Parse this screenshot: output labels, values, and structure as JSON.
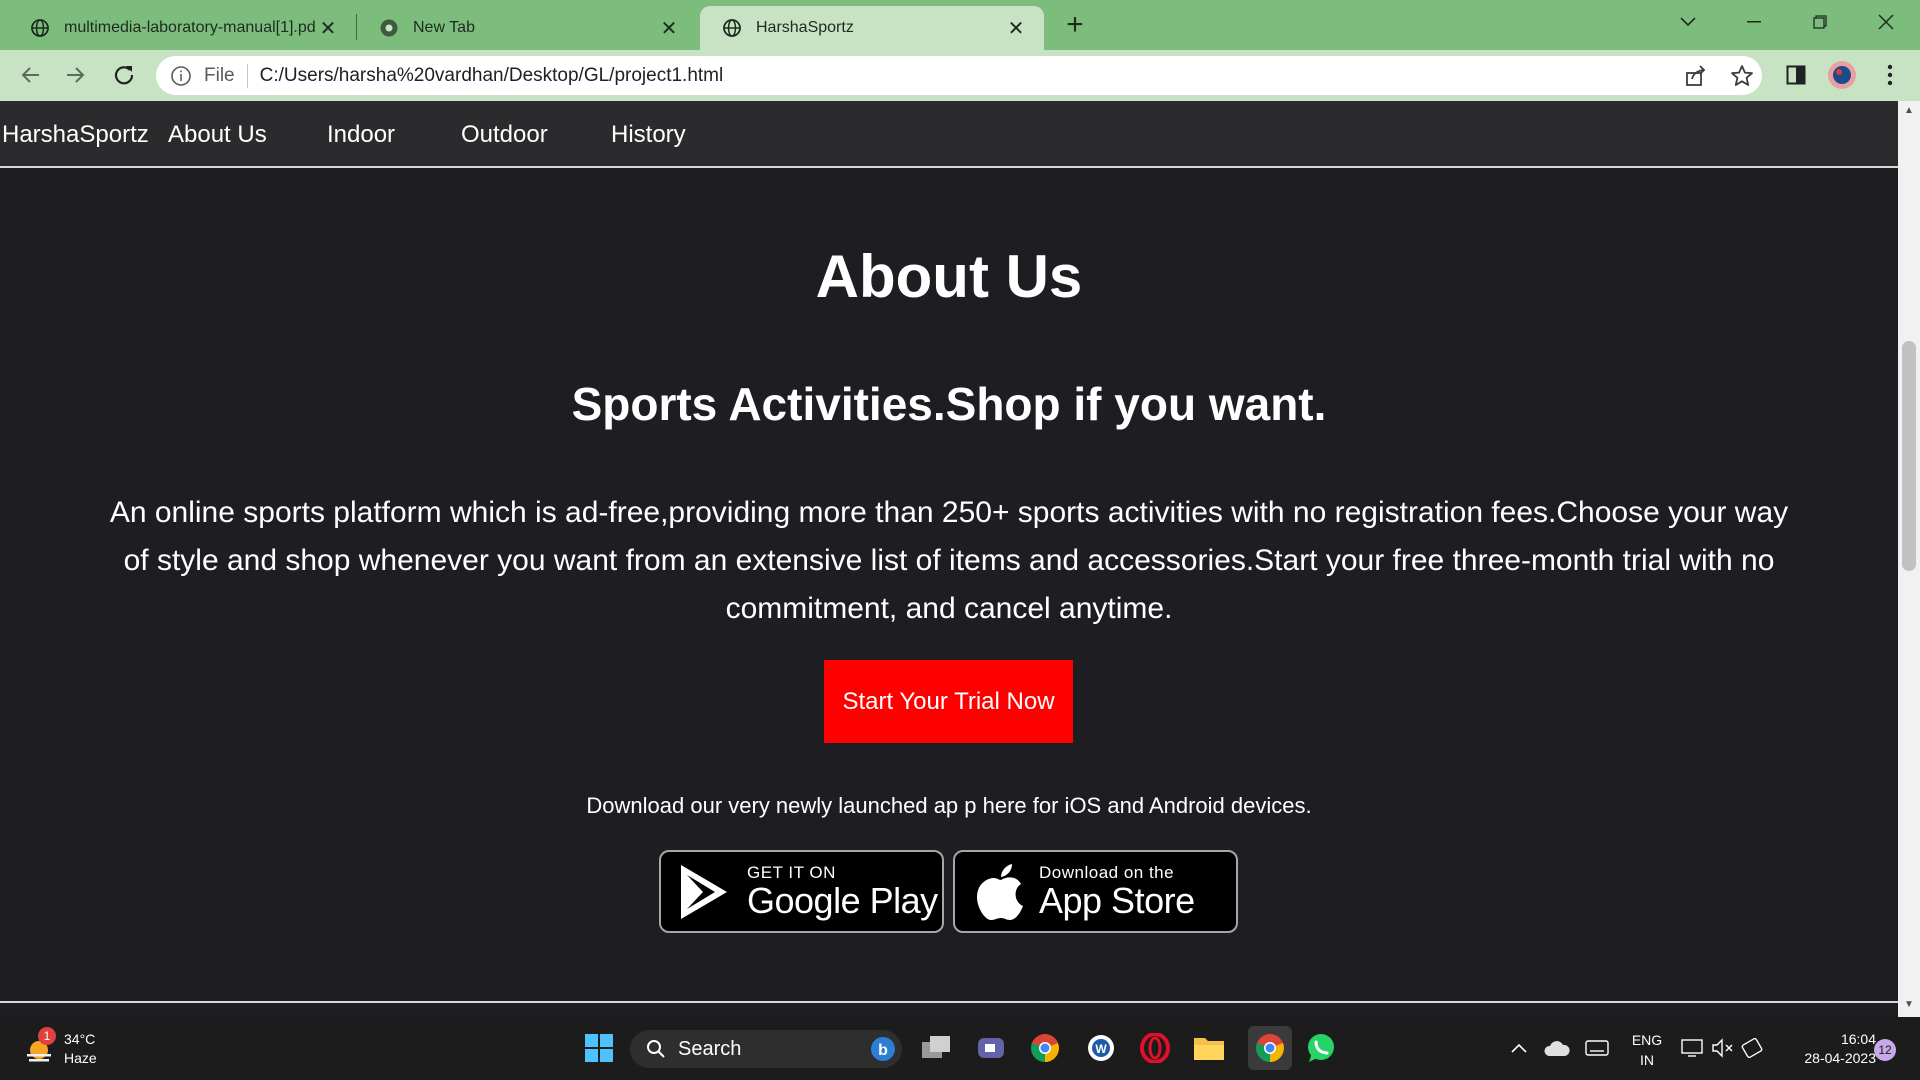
{
  "browser": {
    "tabs": [
      {
        "title": "multimedia-laboratory-manual[1].pdf",
        "active": false
      },
      {
        "title": "New Tab",
        "active": false
      },
      {
        "title": "HarshaSportz",
        "active": true
      }
    ],
    "new_tab_label": "+",
    "url_scheme": "File",
    "url": "C:/Users/harsha%20vardhan/Desktop/GL/project1.html"
  },
  "site": {
    "nav": {
      "brand": "HarshaSportz",
      "links": [
        "About Us",
        "Indoor",
        "Outdoor",
        "History"
      ]
    },
    "hero": {
      "title": "About Us",
      "subtitle": "Sports Activities.Shop if you want.",
      "description": "An online sports platform which is ad-free,providing more than 250+ sports activities with no registration fees.Choose your way of style and shop whenever you want from an extensive list of items and accessories.Start your free three-month trial with no commitment, and cancel anytime.",
      "cta_label": "Start Your Trial Now",
      "download_text": "Download our very newly launched ap p here for iOS and Android devices."
    },
    "badges": {
      "google": {
        "small": "GET IT ON",
        "big": "Google Play"
      },
      "apple": {
        "small": "Download on the",
        "big": "App Store"
      }
    }
  },
  "taskbar": {
    "weather": {
      "temp": "34°C",
      "condition": "Haze",
      "badge": "1"
    },
    "search_label": "Search",
    "lang": {
      "line1": "ENG",
      "line2": "IN"
    },
    "clock": {
      "time": "16:04",
      "date": "28-04-2023"
    },
    "notifications": "12"
  },
  "colors": {
    "tab_bar": "#7cbd7d",
    "toolbar": "#c7e3c4",
    "page_bg": "#1e1e22",
    "cta": "#ff0000"
  }
}
